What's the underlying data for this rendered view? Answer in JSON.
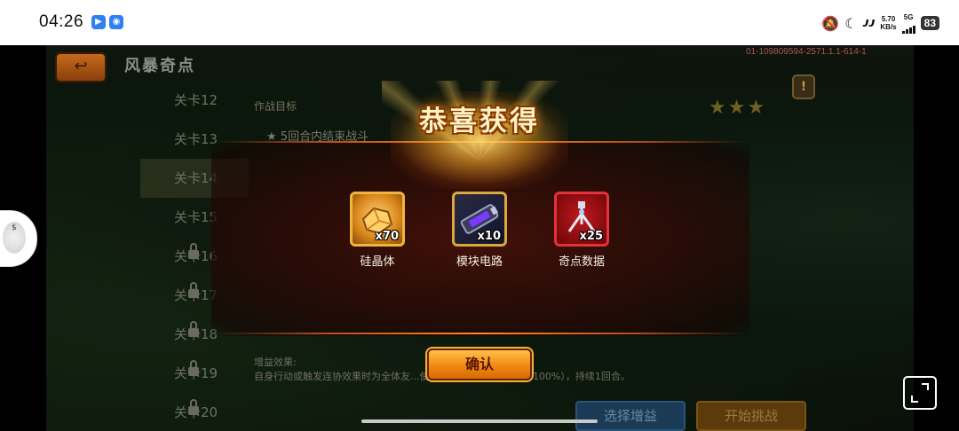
{
  "status_bar": {
    "time": "04:26",
    "net_speed_value": "5.70",
    "net_speed_unit": "KB/s",
    "network": "5G",
    "battery": "83"
  },
  "game": {
    "title": "风暴奇点",
    "version": "01-109809594-2571.1.1-614-1",
    "stages": [
      {
        "label": "关卡12",
        "locked": false
      },
      {
        "label": "关卡13",
        "locked": false
      },
      {
        "label": "关卡14",
        "locked": false,
        "selected": true
      },
      {
        "label": "关卡15",
        "locked": false
      },
      {
        "label": "关卡16",
        "locked": true
      },
      {
        "label": "关卡17",
        "locked": true
      },
      {
        "label": "关卡18",
        "locked": true
      },
      {
        "label": "关卡19",
        "locked": true
      },
      {
        "label": "关卡20",
        "locked": true
      }
    ],
    "objective_header": "作战目标",
    "objective_1": "5回合内结束战斗",
    "buff_title": "增益效果:",
    "buff_text": "自身行动或触发连协效果时为全体友...使武器伤害提升5%（最多100%），持续1回合。",
    "select_buff_label": "选择增益",
    "start_challenge_label": "开始挑战"
  },
  "popup": {
    "title": "恭喜获得",
    "items": [
      {
        "name": "硅晶体",
        "quantity": "x70",
        "icon": "silicon-crystal-icon"
      },
      {
        "name": "模块电路",
        "quantity": "x10",
        "icon": "module-circuit-icon"
      },
      {
        "name": "奇点数据",
        "quantity": "x25",
        "icon": "singularity-data-icon"
      }
    ],
    "confirm_label": "确认"
  },
  "colors": {
    "confirm_button": "#f08a10",
    "popup_bg": "#2a0a06",
    "title_text": "#fff3c2"
  }
}
